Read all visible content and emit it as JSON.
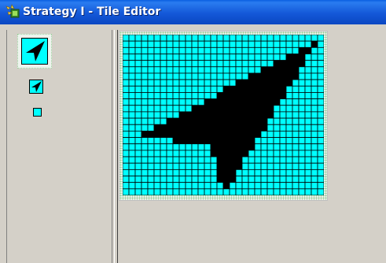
{
  "window": {
    "title": "Strategy I - Tile Editor",
    "app_icon": "strategy-app-icon"
  },
  "tiles": [
    {
      "label": "",
      "size": "large",
      "selected": true
    },
    {
      "label": "",
      "size": "medium",
      "selected": false
    },
    {
      "label": "",
      "size": "small",
      "selected": false
    }
  ],
  "editor": {
    "grid_columns": 32,
    "grid_rows": 25,
    "cell_color": "#00ffff",
    "ink_color": "#000000",
    "gridline_color": "#000000",
    "selection_border_color": "#9ed09e",
    "sprite_icon": "arrow-cursor-icon"
  },
  "colors": {
    "titlebar": "#0a47c2",
    "background": "#d4d0c8",
    "title_text": "#ffffff"
  }
}
